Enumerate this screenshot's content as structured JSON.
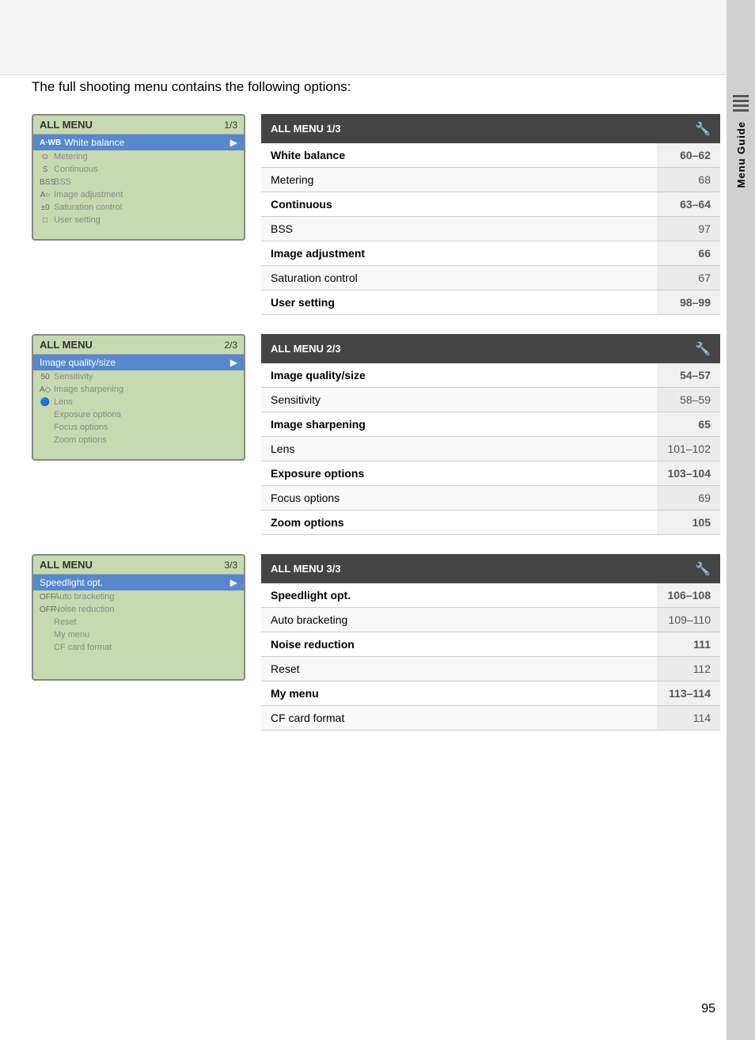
{
  "page": {
    "number": "95",
    "intro": "The full shooting menu contains the following options:"
  },
  "sidebar": {
    "label": "Menu Guide"
  },
  "menus": [
    {
      "id": "menu1",
      "lcd": {
        "title": "ALL MENU",
        "page": "1/3",
        "selected": "White balance",
        "selected_prefix": "A·WB",
        "rows": [
          {
            "icon": "⊙",
            "label": "Metering"
          },
          {
            "icon": "S",
            "label": "Continuous"
          },
          {
            "icon": "BSS",
            "label": "BSS"
          },
          {
            "icon": "A○",
            "label": "Image adjustment"
          },
          {
            "icon": "±0",
            "label": "Saturation control"
          },
          {
            "icon": "□",
            "label": "User setting"
          }
        ]
      },
      "table": {
        "header": "ALL MENU 1/3",
        "icon": "⚙",
        "rows": [
          {
            "label": "White balance",
            "page": "60–62",
            "bold": true
          },
          {
            "label": "Metering",
            "page": "68",
            "bold": false
          },
          {
            "label": "Continuous",
            "page": "63–64",
            "bold": true
          },
          {
            "label": "BSS",
            "page": "97",
            "bold": false
          },
          {
            "label": "Image adjustment",
            "page": "66",
            "bold": true
          },
          {
            "label": "Saturation control",
            "page": "67",
            "bold": false
          },
          {
            "label": "User setting",
            "page": "98–99",
            "bold": true
          }
        ]
      }
    },
    {
      "id": "menu2",
      "lcd": {
        "title": "ALL MENU",
        "page": "2/3",
        "selected": "Image quality/size",
        "selected_prefix": "",
        "rows": [
          {
            "icon": "50",
            "label": "Sensitivity"
          },
          {
            "icon": "A◇",
            "label": "Image sharpening"
          },
          {
            "icon": "🔵",
            "label": "Lens"
          },
          {
            "icon": "",
            "label": "Exposure options"
          },
          {
            "icon": "",
            "label": "Focus options"
          },
          {
            "icon": "",
            "label": "Zoom options"
          }
        ]
      },
      "table": {
        "header": "ALL MENU 2/3",
        "icon": "⚙",
        "rows": [
          {
            "label": "Image quality/size",
            "page": "54–57",
            "bold": true
          },
          {
            "label": "Sensitivity",
            "page": "58–59",
            "bold": false
          },
          {
            "label": "Image sharpening",
            "page": "65",
            "bold": true
          },
          {
            "label": "Lens",
            "page": "101–102",
            "bold": false
          },
          {
            "label": "Exposure options",
            "page": "103–104",
            "bold": true
          },
          {
            "label": "Focus options",
            "page": "69",
            "bold": false
          },
          {
            "label": "Zoom options",
            "page": "105",
            "bold": true
          }
        ]
      }
    },
    {
      "id": "menu3",
      "lcd": {
        "title": "ALL MENU",
        "page": "3/3",
        "selected": "Speedlight opt.",
        "selected_prefix": "",
        "rows": [
          {
            "icon": "OFF",
            "label": "Auto bracketing"
          },
          {
            "icon": "OFF",
            "label": "Noise reduction"
          },
          {
            "icon": "",
            "label": "Reset"
          },
          {
            "icon": "",
            "label": "My menu"
          },
          {
            "icon": "",
            "label": "CF card format"
          }
        ]
      },
      "table": {
        "header": "ALL MENU 3/3",
        "icon": "⚙",
        "rows": [
          {
            "label": "Speedlight opt.",
            "page": "106–108",
            "bold": true
          },
          {
            "label": "Auto bracketing",
            "page": "109–110",
            "bold": false
          },
          {
            "label": "Noise reduction",
            "page": "111",
            "bold": true
          },
          {
            "label": "Reset",
            "page": "112",
            "bold": false
          },
          {
            "label": "My menu",
            "page": "113–114",
            "bold": true
          },
          {
            "label": "CF card format",
            "page": "114",
            "bold": false
          }
        ]
      }
    }
  ]
}
